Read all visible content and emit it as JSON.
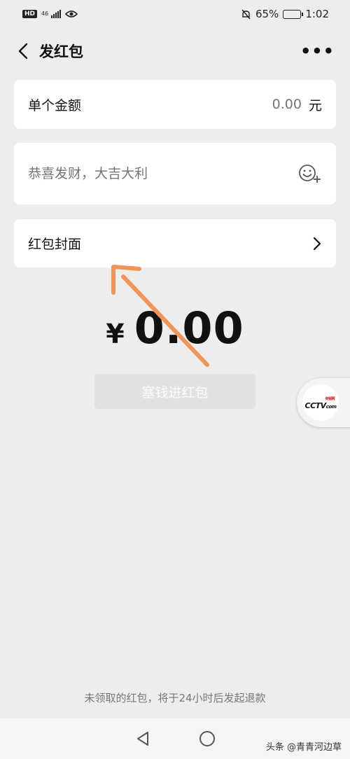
{
  "status_bar": {
    "hd": "HD",
    "network": "46",
    "battery": "65%",
    "battery_level": 0.65,
    "time": "1:02"
  },
  "header": {
    "title": "发红包",
    "more": "•••"
  },
  "amount": {
    "label": "单个金额",
    "value": "0.00",
    "unit": "元"
  },
  "wish": {
    "placeholder": "恭喜发财，大吉大利"
  },
  "cover": {
    "label": "红包封面"
  },
  "total": {
    "symbol": "¥",
    "value": "0.00"
  },
  "submit": {
    "label": "塞钱进红包"
  },
  "float_ball": {
    "label": "CCTV",
    "sub": "com",
    "small": "央视网"
  },
  "footer": {
    "note": "未领取的红包，将于24小时后发起退款"
  },
  "watermark": "头条 @青青河边草",
  "colors": {
    "background": "#ededed",
    "card": "#ffffff",
    "annotation_arrow": "#f0955a"
  }
}
